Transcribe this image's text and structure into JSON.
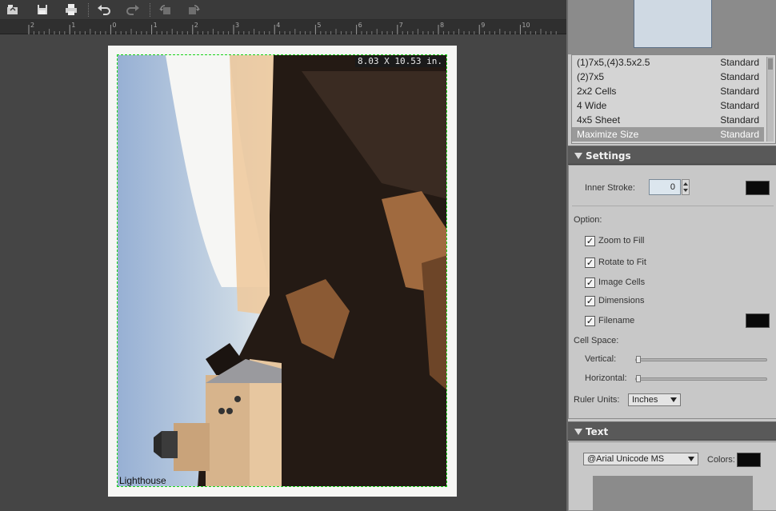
{
  "toolbar": {
    "buttons": [
      {
        "name": "open-icon"
      },
      {
        "name": "save-icon"
      },
      {
        "name": "print-icon"
      },
      {
        "name": "undo-icon"
      },
      {
        "name": "redo-icon"
      },
      {
        "name": "rotate-left-icon"
      },
      {
        "name": "rotate-right-icon"
      }
    ]
  },
  "ruler": {
    "ticks": [
      "2",
      "1",
      "0",
      "1",
      "2",
      "3",
      "4",
      "5",
      "6",
      "7",
      "8",
      "9",
      "10"
    ]
  },
  "canvas": {
    "dimensions_badge": "8.03 X 10.53 in.",
    "filename_label": "Lighthouse"
  },
  "layouts": {
    "items": [
      {
        "name": "(1)7x5,(4)3.5x2.5",
        "type": "Standard"
      },
      {
        "name": "(2)7x5",
        "type": "Standard"
      },
      {
        "name": "2x2 Cells",
        "type": "Standard"
      },
      {
        "name": "4 Wide",
        "type": "Standard"
      },
      {
        "name": "4x5 Sheet",
        "type": "Standard"
      },
      {
        "name": "Maximize Size",
        "type": "Standard"
      }
    ],
    "selected": "Maximize Size"
  },
  "settings": {
    "header": "Settings",
    "inner_stroke_label": "Inner Stroke:",
    "inner_stroke_value": "0",
    "inner_stroke_color": "#0a0a0a",
    "option_label": "Option:",
    "options": {
      "zoom_to_fill": {
        "label": "Zoom to Fill",
        "checked": true
      },
      "rotate_to_fit": {
        "label": "Rotate to Fit",
        "checked": true
      },
      "image_cells": {
        "label": "Image Cells",
        "checked": true
      },
      "dimensions": {
        "label": "Dimensions",
        "checked": true
      },
      "filename": {
        "label": "Filename",
        "checked": true
      }
    },
    "filename_color": "#0a0a0a",
    "cell_space_label": "Cell Space:",
    "vertical_label": "Vertical:",
    "horizontal_label": "Horizontal:",
    "ruler_units_label": "Ruler Units:",
    "ruler_units_value": "Inches"
  },
  "text": {
    "header": "Text",
    "font_value": "@Arial Unicode MS",
    "colors_label": "Colors:",
    "color": "#0a0a0a"
  },
  "colors": {
    "crop_border": "#19d419",
    "panel_bg": "#c8c8c8",
    "workspace_bg": "#454545"
  }
}
